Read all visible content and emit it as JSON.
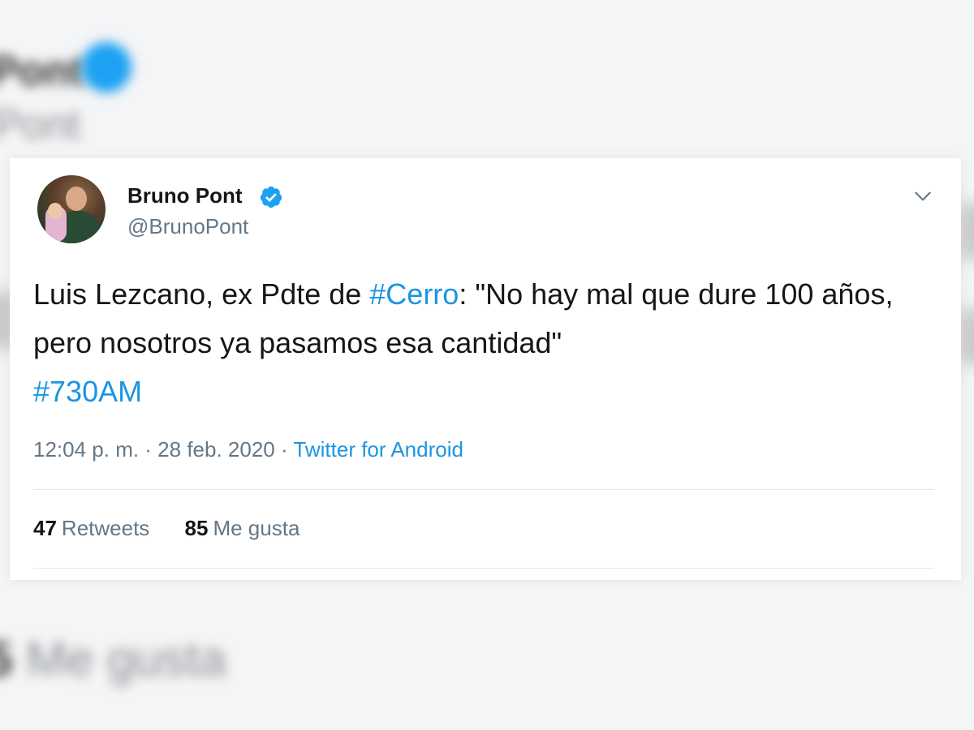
{
  "background": {
    "name": "Pont",
    "handle": "Pont",
    "likes_count": "5",
    "likes_label": "Me gusta"
  },
  "tweet": {
    "display_name": "Bruno Pont",
    "handle": "@BrunoPont",
    "text_part1": "Luis Lezcano, ex Pdte de ",
    "hashtag1": "#Cerro",
    "text_part2": ": \"No hay mal que dure 100 años, pero nosotros ya pasamos esa cantidad\"",
    "hashtag2": "#730AM",
    "timestamp": "12:04 p. m. · 28 feb. 2020",
    "separator": " · ",
    "source": "Twitter for Android",
    "retweets_count": "47",
    "retweets_label": "Retweets",
    "likes_count": "85",
    "likes_label": "Me gusta"
  },
  "icons": {
    "verified": "verified-badge-icon",
    "menu": "chevron-down-icon"
  },
  "colors": {
    "link": "#1b95e0",
    "verified": "#1da1f2",
    "secondary_text": "#657786",
    "primary_text": "#14171a",
    "divider": "#e1e8ed"
  }
}
